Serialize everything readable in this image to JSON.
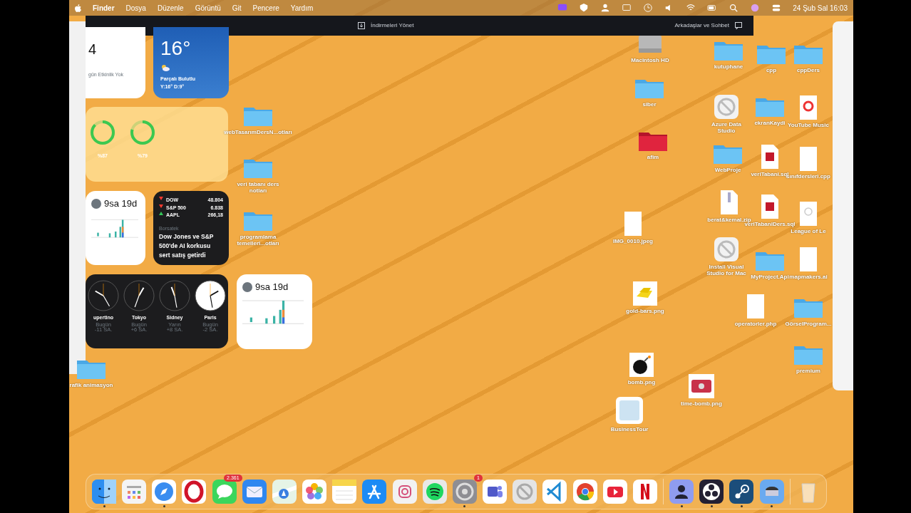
{
  "menu_bar": {
    "app": "Finder",
    "menus": [
      "Dosya",
      "Düzenle",
      "Görüntü",
      "Git",
      "Pencere",
      "Yardım"
    ],
    "clock": "24 Şub Sal 16:03"
  },
  "overlay_bar": {
    "left": "İndirmeleri Yönet",
    "right": "Arkadaşlar ve Sohbet"
  },
  "widgets": {
    "calendar": {
      "day": "4",
      "note": "gün Etkinlik Yok"
    },
    "weather": {
      "temp": "16°",
      "condition": "Parçalı Bulutlu",
      "range": "Y:16° D:9°"
    },
    "batteries": [
      {
        "reading": "%87",
        "level": 0.87
      },
      {
        "reading": "%79",
        "level": 0.79
      }
    ],
    "screen_time": [
      {
        "total": "9sa 19d"
      },
      {
        "total": "9sa 19d"
      }
    ],
    "stocks": {
      "quotes": [
        {
          "symbol": "DOW",
          "value": "48.804",
          "up": false
        },
        {
          "symbol": "S&P 500",
          "value": "6.838",
          "up": false
        },
        {
          "symbol": "AAPL",
          "value": "266,18",
          "up": true
        }
      ],
      "source": "Borsatek",
      "headline": "Dow Jones ve S&P 500'de AI korkusu sert satış getirdi"
    },
    "clocks": [
      {
        "city": "upertino",
        "day": "Bugün",
        "offset": "-11 SA.",
        "dark": true
      },
      {
        "city": "Tokyo",
        "day": "Bugün",
        "offset": "+6 SA.",
        "dark": true
      },
      {
        "city": "Sidney",
        "day": "Yarın",
        "offset": "+8 SA.",
        "dark": true
      },
      {
        "city": "Paris",
        "day": "Bugün",
        "offset": "-2 SA.",
        "dark": false
      }
    ]
  },
  "desktop_items": [
    {
      "label": "webTasarımDersN...otları",
      "kind": "folder"
    },
    {
      "label": "veri tabanı ders notları",
      "kind": "folder"
    },
    {
      "label": "programlama temelleri...otları",
      "kind": "folder"
    },
    {
      "label": "rafik animasyon",
      "kind": "folder"
    },
    {
      "label": "Macintosh HD",
      "kind": "disk"
    },
    {
      "label": "kutuphane",
      "kind": "folder"
    },
    {
      "label": "cpp",
      "kind": "folder"
    },
    {
      "label": "cppDers",
      "kind": "folder"
    },
    {
      "label": "siber",
      "kind": "folder"
    },
    {
      "label": "Azure Data Studio",
      "kind": "app"
    },
    {
      "label": "ekranKaydi",
      "kind": "folder"
    },
    {
      "label": "YouTube Music",
      "kind": "web"
    },
    {
      "label": "afim",
      "kind": "red-folder"
    },
    {
      "label": "WebProje",
      "kind": "folder"
    },
    {
      "label": "veriTabani.sql",
      "kind": "sql"
    },
    {
      "label": "sınıfdersleri.cpp",
      "kind": "file"
    },
    {
      "label": "berat&kemal.zip",
      "kind": "zip"
    },
    {
      "label": "veriTabaniDers.sql",
      "kind": "sql"
    },
    {
      "label": "League of Le",
      "kind": "unknown"
    },
    {
      "label": "IMG_0010.jpeg",
      "kind": "file"
    },
    {
      "label": "Install Visual Studio for Mac",
      "kind": "app"
    },
    {
      "label": "MyProject.Api",
      "kind": "folder"
    },
    {
      "label": "mapmakers.ai",
      "kind": "file"
    },
    {
      "label": "gold-bars.png",
      "kind": "gold"
    },
    {
      "label": "operatorler.php",
      "kind": "file"
    },
    {
      "label": "GörselProgram...",
      "kind": "folder"
    },
    {
      "label": "premium",
      "kind": "folder"
    },
    {
      "label": "bomb.png",
      "kind": "bomb"
    },
    {
      "label": "time-bomb.png",
      "kind": "dynamite"
    },
    {
      "label": "BusinessTour",
      "kind": "image"
    }
  ],
  "dock": [
    {
      "kind": "finder",
      "running": true
    },
    {
      "kind": "launchpad",
      "running": false
    },
    {
      "kind": "safari",
      "running": true
    },
    {
      "kind": "opera",
      "running": false
    },
    {
      "kind": "messages",
      "running": false,
      "badge": "2.361"
    },
    {
      "kind": "mail",
      "running": false
    },
    {
      "kind": "maps",
      "running": false
    },
    {
      "kind": "photos",
      "running": false
    },
    {
      "kind": "notes",
      "running": false
    },
    {
      "kind": "appstore",
      "running": false
    },
    {
      "kind": "instagram",
      "running": false
    },
    {
      "kind": "spotify",
      "running": false
    },
    {
      "kind": "settings",
      "running": true,
      "badge": "1"
    },
    {
      "kind": "teams",
      "running": false
    },
    {
      "kind": "blocked",
      "running": false
    },
    {
      "kind": "vscode",
      "running": false
    },
    {
      "kind": "chrome",
      "running": false
    },
    {
      "kind": "youtube",
      "running": false
    },
    {
      "kind": "netflix",
      "running": false
    },
    {
      "kind": "separator"
    },
    {
      "kind": "person",
      "running": true
    },
    {
      "kind": "obs",
      "running": true
    },
    {
      "kind": "steam",
      "running": true
    },
    {
      "kind": "disk-app",
      "running": true
    },
    {
      "kind": "separator"
    },
    {
      "kind": "trash",
      "running": false
    }
  ]
}
